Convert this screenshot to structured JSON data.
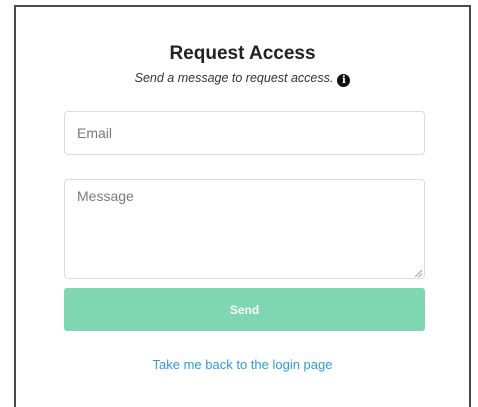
{
  "form": {
    "title": "Request Access",
    "subtitle": "Send a message to request access.",
    "info_icon": "info-icon",
    "email_placeholder": "Email",
    "message_placeholder": "Message",
    "send_label": "Send",
    "back_link": "Take me back to the login page"
  },
  "colors": {
    "send_button": "#7fd6b3",
    "link": "#2f9bd8",
    "border": "#d8dde0"
  }
}
